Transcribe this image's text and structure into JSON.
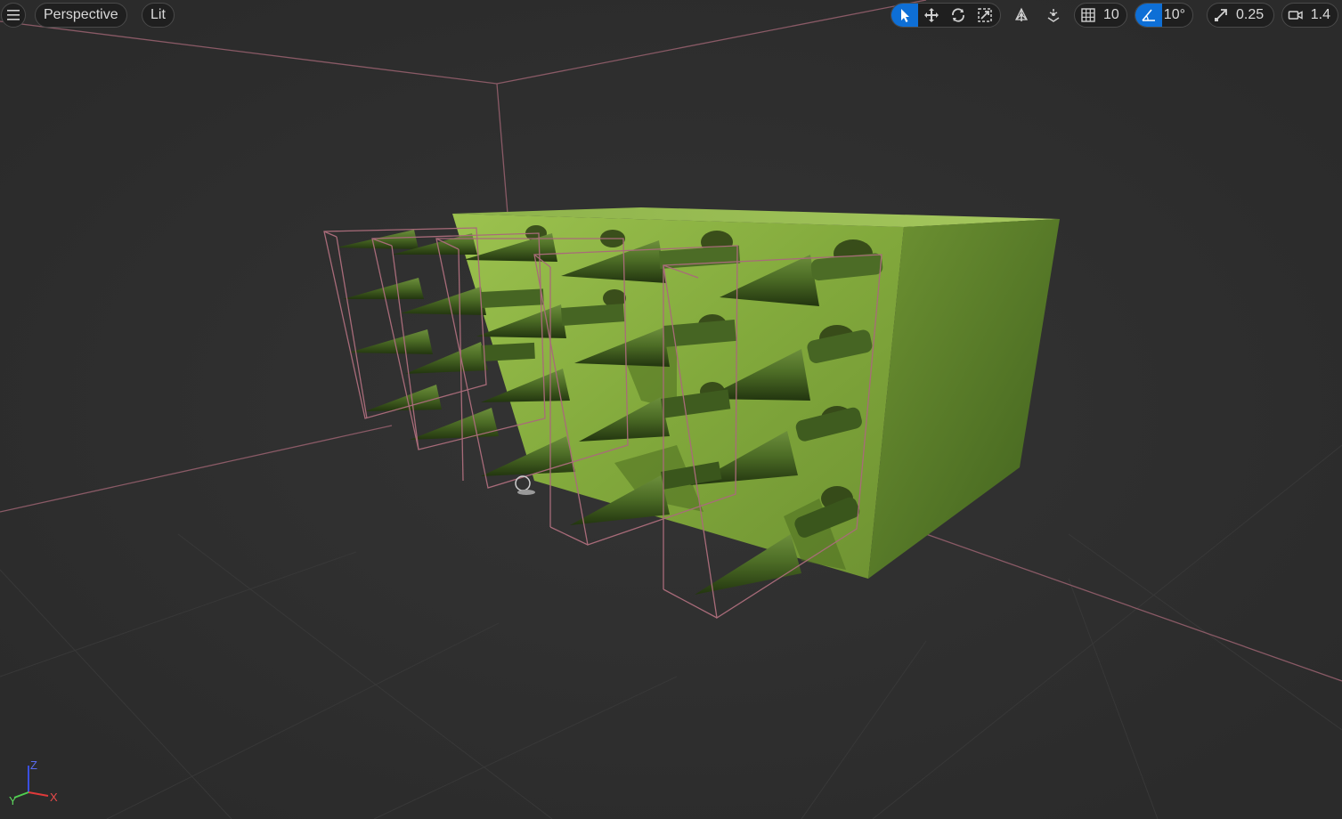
{
  "toolbar": {
    "view_mode": "Perspective",
    "lighting_mode": "Lit",
    "grid_snap_value": "10",
    "rotation_snap_value": "10°",
    "scale_snap_value": "0.25",
    "camera_speed_value": "1.4"
  },
  "axis_gizmo": {
    "z_label": "Z",
    "x_label": "X",
    "y_label": "Y"
  },
  "colors": {
    "viewport_bg": "#2e2e2e",
    "active_tool": "#0e6fd6",
    "selection_outline": "#b0707e",
    "moss_light": "#8fb54a",
    "moss_dark": "#3f5a1c"
  },
  "icons": {
    "menu": "hamburger-menu-icon",
    "select": "select-arrow-icon",
    "translate": "translate-icon",
    "rotate": "rotate-icon",
    "scale": "scale-icon",
    "world_local": "world-space-icon",
    "surface_snap": "surface-snap-icon",
    "grid_snap": "grid-icon",
    "rotation_snap": "angle-icon",
    "scale_snap": "scale-snap-icon",
    "camera_speed": "camera-icon"
  }
}
